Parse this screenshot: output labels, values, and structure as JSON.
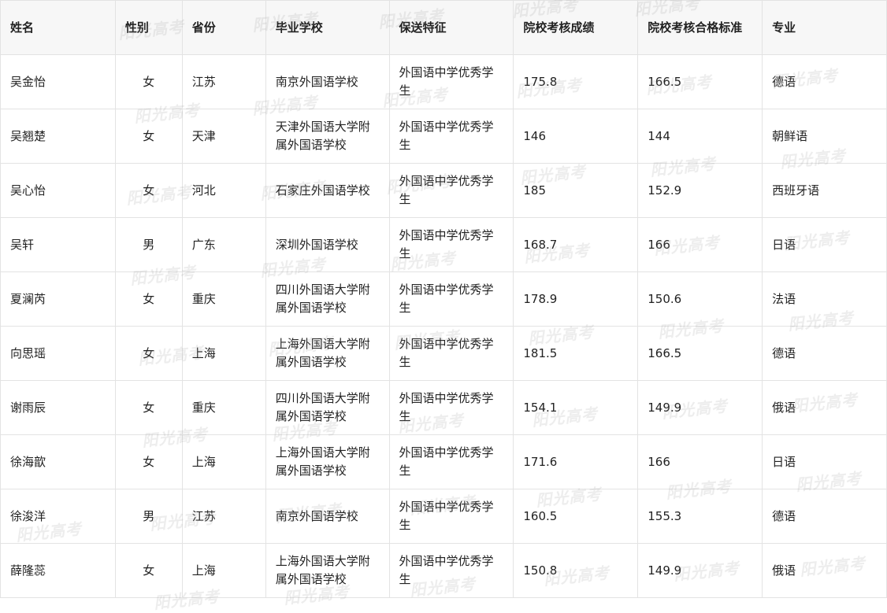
{
  "watermark": "阳光高考",
  "table": {
    "headers": [
      "姓名",
      "性别",
      "省份",
      "毕业学校",
      "保送特征",
      "院校考核成绩",
      "院校考核合格标准",
      "专业"
    ],
    "rows": [
      [
        "吴金怡",
        "女",
        "江苏",
        "南京外国语学校",
        "外国语中学优秀学生",
        "175.8",
        "166.5",
        "德语"
      ],
      [
        "吴翘楚",
        "女",
        "天津",
        "天津外国语大学附属外国语学校",
        "外国语中学优秀学生",
        "146",
        "144",
        "朝鲜语"
      ],
      [
        "吴心怡",
        "女",
        "河北",
        "石家庄外国语学校",
        "外国语中学优秀学生",
        "185",
        "152.9",
        "西班牙语"
      ],
      [
        "吴轩",
        "男",
        "广东",
        "深圳外国语学校",
        "外国语中学优秀学生",
        "168.7",
        "166",
        "日语"
      ],
      [
        "夏澜芮",
        "女",
        "重庆",
        "四川外国语大学附属外国语学校",
        "外国语中学优秀学生",
        "178.9",
        "150.6",
        "法语"
      ],
      [
        "向思瑶",
        "女",
        "上海",
        "上海外国语大学附属外国语学校",
        "外国语中学优秀学生",
        "181.5",
        "166.5",
        "德语"
      ],
      [
        "谢雨辰",
        "女",
        "重庆",
        "四川外国语大学附属外国语学校",
        "外国语中学优秀学生",
        "154.1",
        "149.9",
        "俄语"
      ],
      [
        "徐海歆",
        "女",
        "上海",
        "上海外国语大学附属外国语学校",
        "外国语中学优秀学生",
        "171.6",
        "166",
        "日语"
      ],
      [
        "徐浚洋",
        "男",
        "江苏",
        "南京外国语学校",
        "外国语中学优秀学生",
        "160.5",
        "155.3",
        "德语"
      ],
      [
        "薛隆蕊",
        "女",
        "上海",
        "上海外国语大学附属外国语学校",
        "外国语中学优秀学生",
        "150.8",
        "149.9",
        "俄语"
      ]
    ]
  }
}
